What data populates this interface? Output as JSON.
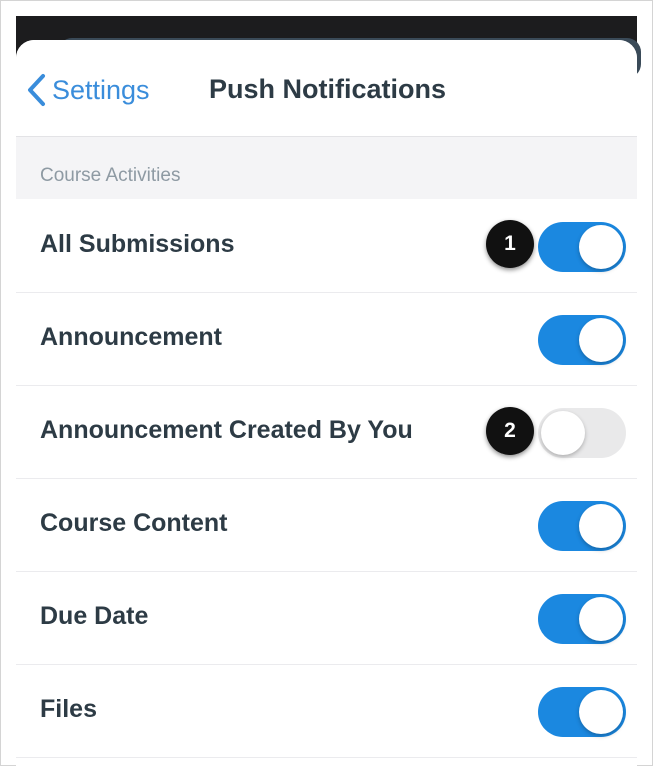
{
  "nav": {
    "back_label": "Settings",
    "title": "Push Notifications"
  },
  "section": {
    "header": "Course Activities"
  },
  "rows": [
    {
      "label": "All Submissions",
      "enabled": true
    },
    {
      "label": "Announcement",
      "enabled": true
    },
    {
      "label": "Announcement Created By You",
      "enabled": false
    },
    {
      "label": "Course Content",
      "enabled": true
    },
    {
      "label": "Due Date",
      "enabled": true
    },
    {
      "label": "Files",
      "enabled": true
    }
  ],
  "callouts": [
    "1",
    "2"
  ],
  "colors": {
    "accent": "#1b88e0",
    "link": "#3a8ddb",
    "toggle_off": "#e9e9ea",
    "text": "#2d3b45"
  },
  "icons": {
    "back": "chevron-left-icon"
  }
}
